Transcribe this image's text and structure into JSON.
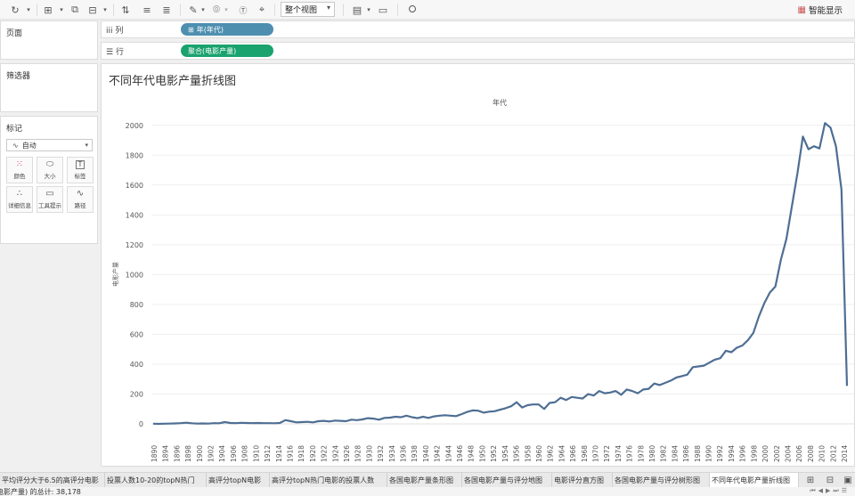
{
  "toolbar": {
    "view_dropdown": "整个视图",
    "show_me": "智能显示"
  },
  "panes": {
    "pages": "页面",
    "filters": "筛选器",
    "marks": "标记",
    "marks_type": "自动",
    "cards": [
      {
        "label": "颜色",
        "icon": "color-dots-icon"
      },
      {
        "label": "大小",
        "icon": "size-icon"
      },
      {
        "label": "标签",
        "icon": "label-icon"
      },
      {
        "label": "详细信息",
        "icon": "detail-icon"
      },
      {
        "label": "工具提示",
        "icon": "tooltip-icon"
      },
      {
        "label": "路径",
        "icon": "path-icon"
      }
    ]
  },
  "shelves": {
    "columns_label": "列",
    "rows_label": "行",
    "columns_pill": "年(年代)",
    "rows_pill": "聚合(电影产量)"
  },
  "view": {
    "title": "不同年代电影产量折线图",
    "header": "年代"
  },
  "chart_data": {
    "type": "line",
    "xlabel": "年代",
    "ylabel": "电影产量",
    "ylim": [
      0,
      2100
    ],
    "yticks": [
      0,
      200,
      400,
      600,
      800,
      1000,
      1200,
      1400,
      1600,
      1800,
      2000
    ],
    "x_tick_labels": [
      "1890",
      "1894",
      "1896",
      "1898",
      "1900",
      "1902",
      "1904",
      "1906",
      "1908",
      "1910",
      "1912",
      "1914",
      "1916",
      "1918",
      "1920",
      "1922",
      "1924",
      "1926",
      "1928",
      "1930",
      "1932",
      "1934",
      "1936",
      "1938",
      "1940",
      "1942",
      "1944",
      "1946",
      "1948",
      "1950",
      "1952",
      "1954",
      "1956",
      "1958",
      "1960",
      "1962",
      "1964",
      "1966",
      "1968",
      "1970",
      "1972",
      "1974",
      "1976",
      "1978",
      "1980",
      "1982",
      "1984",
      "1986",
      "1988",
      "1990",
      "1992",
      "1994",
      "1996",
      "1998",
      "2000",
      "2002",
      "2004",
      "2006",
      "2008",
      "2010",
      "2012",
      "2014"
    ],
    "grid": true,
    "color": "#4e6e94",
    "series": [
      {
        "points": [
          [
            1890,
            1
          ],
          [
            1891,
            0
          ],
          [
            1892,
            1
          ],
          [
            1893,
            2
          ],
          [
            1894,
            3
          ],
          [
            1895,
            5
          ],
          [
            1896,
            8
          ],
          [
            1897,
            4
          ],
          [
            1898,
            2
          ],
          [
            1899,
            3
          ],
          [
            1900,
            2
          ],
          [
            1901,
            5
          ],
          [
            1902,
            4
          ],
          [
            1903,
            12
          ],
          [
            1904,
            6
          ],
          [
            1905,
            5
          ],
          [
            1906,
            7
          ],
          [
            1907,
            6
          ],
          [
            1908,
            5
          ],
          [
            1909,
            6
          ],
          [
            1910,
            5
          ],
          [
            1911,
            5
          ],
          [
            1912,
            4
          ],
          [
            1913,
            6
          ],
          [
            1914,
            25
          ],
          [
            1915,
            18
          ],
          [
            1916,
            10
          ],
          [
            1917,
            12
          ],
          [
            1918,
            14
          ],
          [
            1919,
            10
          ],
          [
            1920,
            18
          ],
          [
            1921,
            20
          ],
          [
            1922,
            16
          ],
          [
            1923,
            22
          ],
          [
            1924,
            20
          ],
          [
            1925,
            18
          ],
          [
            1926,
            28
          ],
          [
            1927,
            25
          ],
          [
            1928,
            30
          ],
          [
            1929,
            38
          ],
          [
            1930,
            35
          ],
          [
            1931,
            28
          ],
          [
            1932,
            40
          ],
          [
            1933,
            42
          ],
          [
            1934,
            48
          ],
          [
            1935,
            45
          ],
          [
            1936,
            55
          ],
          [
            1937,
            45
          ],
          [
            1938,
            38
          ],
          [
            1939,
            48
          ],
          [
            1940,
            40
          ],
          [
            1941,
            50
          ],
          [
            1942,
            55
          ],
          [
            1943,
            58
          ],
          [
            1944,
            55
          ],
          [
            1945,
            52
          ],
          [
            1946,
            65
          ],
          [
            1947,
            80
          ],
          [
            1948,
            90
          ],
          [
            1949,
            88
          ],
          [
            1950,
            75
          ],
          [
            1951,
            82
          ],
          [
            1952,
            85
          ],
          [
            1953,
            95
          ],
          [
            1954,
            105
          ],
          [
            1955,
            118
          ],
          [
            1956,
            145
          ],
          [
            1957,
            110
          ],
          [
            1958,
            125
          ],
          [
            1959,
            130
          ],
          [
            1960,
            130
          ],
          [
            1961,
            100
          ],
          [
            1962,
            140
          ],
          [
            1963,
            145
          ],
          [
            1964,
            175
          ],
          [
            1965,
            160
          ],
          [
            1966,
            180
          ],
          [
            1967,
            175
          ],
          [
            1968,
            170
          ],
          [
            1969,
            200
          ],
          [
            1970,
            190
          ],
          [
            1971,
            220
          ],
          [
            1972,
            205
          ],
          [
            1973,
            210
          ],
          [
            1974,
            220
          ],
          [
            1975,
            195
          ],
          [
            1976,
            230
          ],
          [
            1977,
            220
          ],
          [
            1978,
            205
          ],
          [
            1979,
            230
          ],
          [
            1980,
            235
          ],
          [
            1981,
            270
          ],
          [
            1982,
            260
          ],
          [
            1983,
            275
          ],
          [
            1984,
            290
          ],
          [
            1985,
            310
          ],
          [
            1986,
            320
          ],
          [
            1987,
            330
          ],
          [
            1988,
            380
          ],
          [
            1989,
            385
          ],
          [
            1990,
            390
          ],
          [
            1991,
            410
          ],
          [
            1992,
            430
          ],
          [
            1993,
            440
          ],
          [
            1994,
            490
          ],
          [
            1995,
            480
          ],
          [
            1996,
            510
          ],
          [
            1997,
            525
          ],
          [
            1998,
            560
          ],
          [
            1999,
            610
          ],
          [
            2000,
            720
          ],
          [
            2001,
            810
          ],
          [
            2002,
            880
          ],
          [
            2003,
            920
          ],
          [
            2004,
            1100
          ],
          [
            2005,
            1240
          ],
          [
            2006,
            1460
          ],
          [
            2007,
            1680
          ],
          [
            2008,
            1925
          ],
          [
            2009,
            1840
          ],
          [
            2010,
            1860
          ],
          [
            2011,
            1845
          ],
          [
            2012,
            2015
          ],
          [
            2013,
            1985
          ],
          [
            2014,
            1860
          ],
          [
            2015,
            1570
          ],
          [
            2016,
            255
          ]
        ]
      }
    ]
  },
  "tabs": [
    {
      "label": "平均评分大于6.5的高评分电影"
    },
    {
      "label": "投票人数10-20的topN热门"
    },
    {
      "label": "高评分topN电影"
    },
    {
      "label": "高评分topN热门电影的投票人数"
    },
    {
      "label": "各国电影产量条形图"
    },
    {
      "label": "各国电影产量与评分地图"
    },
    {
      "label": "电影评分直方图"
    },
    {
      "label": "各国电影产量与评分树形图"
    },
    {
      "label": "不同年代电影产量折线图"
    }
  ],
  "status": {
    "text": "电影产量) 的总计: 38,178"
  }
}
